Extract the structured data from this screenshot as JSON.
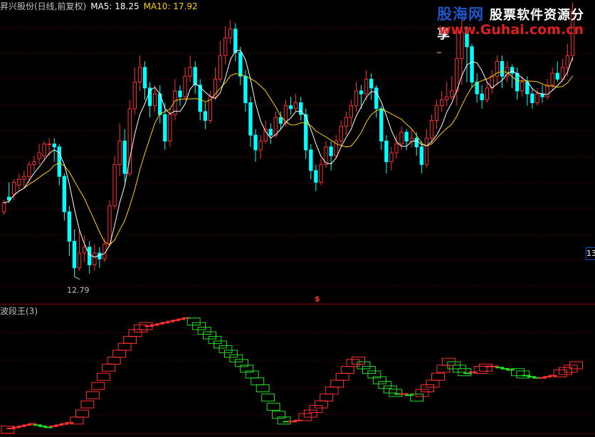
{
  "header": {
    "stock_label": "昇兴股份(日线,前复权)",
    "ma5_label": "MA5: 18.25",
    "ma10_label": "MA10: 17.92",
    "colors": {
      "title": "#c0c0c0",
      "ma5": "#ffffff",
      "ma10": "#ffd000"
    }
  },
  "indicator": {
    "title": "波段王(3)"
  },
  "watermark": {
    "brand": "股海网",
    "slogan": "股票软件资源分享",
    "url": "www.Guhai.com.cn"
  },
  "axis": {
    "right_label": "13"
  },
  "annotations": {
    "low_label": "12.79",
    "marker": "$"
  },
  "chart_data": [
    {
      "type": "candlestick",
      "title": "",
      "xlabel": "",
      "ylabel": "",
      "ylim": [
        12.3,
        21.8
      ],
      "grid": true,
      "colors": {
        "up": "#ff3030",
        "down": "#00ffff",
        "ma5": "#ffffff",
        "ma10": "#ffd000",
        "grid": "#7a0000"
      },
      "candles": [
        [
          15.0,
          15.3,
          15.4,
          14.9
        ],
        [
          15.5,
          15.4,
          16.0,
          15.3
        ],
        [
          15.6,
          16.0,
          16.1,
          15.4
        ],
        [
          15.9,
          16.1,
          16.3,
          15.7
        ],
        [
          16.1,
          16.2,
          16.4,
          15.8
        ],
        [
          16.2,
          16.6,
          16.7,
          16.0
        ],
        [
          16.6,
          16.7,
          16.9,
          16.4
        ],
        [
          16.8,
          17.0,
          17.3,
          16.6
        ],
        [
          16.9,
          17.3,
          17.4,
          16.7
        ],
        [
          17.3,
          17.3,
          17.5,
          16.9
        ],
        [
          17.3,
          17.2,
          17.5,
          16.7
        ],
        [
          17.2,
          16.2,
          17.3,
          15.9
        ],
        [
          16.2,
          15.0,
          16.3,
          14.7
        ],
        [
          15.0,
          14.0,
          15.2,
          13.5
        ],
        [
          14.0,
          13.1,
          14.4,
          12.8
        ],
        [
          13.1,
          13.6,
          14.4,
          13.0
        ],
        [
          13.6,
          13.8,
          14.2,
          13.3
        ],
        [
          13.8,
          13.2,
          14.0,
          12.9
        ],
        [
          13.2,
          13.6,
          13.9,
          13.0
        ],
        [
          13.6,
          13.4,
          13.8,
          13.1
        ],
        [
          13.4,
          13.9,
          14.1,
          13.3
        ],
        [
          13.9,
          15.2,
          15.4,
          13.8
        ],
        [
          15.2,
          16.6,
          16.9,
          15.1
        ],
        [
          16.6,
          17.4,
          18.0,
          16.2
        ],
        [
          17.4,
          16.3,
          17.8,
          16.0
        ],
        [
          16.3,
          18.5,
          18.8,
          16.2
        ],
        [
          18.5,
          19.4,
          19.9,
          18.3
        ],
        [
          19.4,
          19.9,
          20.3,
          19.1
        ],
        [
          19.9,
          19.2,
          20.1,
          18.8
        ],
        [
          19.2,
          18.6,
          19.4,
          18.2
        ],
        [
          18.6,
          19.0,
          19.3,
          18.4
        ],
        [
          19.0,
          18.3,
          19.3,
          18.0
        ],
        [
          18.3,
          17.4,
          18.7,
          17.1
        ],
        [
          17.4,
          18.3,
          18.5,
          17.2
        ],
        [
          18.3,
          19.1,
          19.5,
          18.1
        ],
        [
          19.1,
          18.9,
          19.3,
          18.6
        ],
        [
          18.9,
          19.6,
          19.9,
          18.8
        ],
        [
          19.6,
          19.9,
          20.3,
          19.4
        ],
        [
          19.9,
          19.3,
          20.1,
          19.0
        ],
        [
          19.3,
          18.4,
          19.5,
          18.1
        ],
        [
          18.4,
          18.1,
          18.7,
          17.8
        ],
        [
          18.1,
          18.9,
          19.1,
          18.0
        ],
        [
          18.9,
          19.5,
          19.9,
          18.8
        ],
        [
          19.5,
          20.3,
          20.8,
          19.4
        ],
        [
          20.3,
          20.9,
          21.3,
          20.0
        ],
        [
          20.9,
          21.2,
          21.5,
          20.7
        ],
        [
          21.2,
          20.4,
          21.4,
          20.1
        ],
        [
          20.4,
          19.6,
          20.6,
          19.3
        ],
        [
          19.6,
          18.7,
          19.8,
          18.4
        ],
        [
          18.7,
          17.6,
          18.9,
          17.2
        ],
        [
          17.6,
          17.1,
          17.8,
          16.7
        ],
        [
          17.1,
          17.4,
          17.6,
          16.8
        ],
        [
          17.4,
          17.8,
          18.1,
          17.3
        ],
        [
          17.8,
          17.6,
          18.0,
          17.3
        ],
        [
          17.6,
          18.2,
          18.4,
          17.5
        ],
        [
          18.2,
          18.0,
          18.4,
          17.8
        ],
        [
          18.0,
          18.6,
          18.8,
          17.9
        ],
        [
          18.6,
          18.5,
          18.9,
          18.3
        ],
        [
          18.5,
          18.7,
          19.0,
          18.4
        ],
        [
          18.7,
          18.3,
          18.9,
          18.1
        ],
        [
          18.3,
          17.1,
          18.5,
          16.8
        ],
        [
          17.1,
          16.4,
          17.3,
          16.1
        ],
        [
          16.4,
          16.0,
          16.6,
          15.7
        ],
        [
          16.0,
          16.6,
          16.8,
          15.9
        ],
        [
          16.6,
          17.2,
          17.4,
          16.5
        ],
        [
          17.2,
          16.9,
          17.4,
          16.4
        ],
        [
          16.9,
          17.4,
          17.6,
          16.8
        ],
        [
          17.4,
          17.9,
          18.1,
          17.2
        ],
        [
          17.9,
          18.2,
          18.4,
          17.6
        ],
        [
          18.2,
          18.6,
          18.8,
          17.9
        ],
        [
          18.6,
          19.1,
          19.4,
          18.4
        ],
        [
          19.1,
          19.0,
          19.3,
          18.5
        ],
        [
          19.0,
          19.5,
          19.8,
          18.8
        ],
        [
          19.5,
          19.2,
          19.7,
          18.8
        ],
        [
          19.2,
          18.5,
          19.3,
          18.2
        ],
        [
          18.5,
          17.4,
          18.6,
          17.1
        ],
        [
          17.4,
          16.7,
          17.6,
          16.3
        ],
        [
          16.7,
          17.0,
          17.2,
          16.4
        ],
        [
          17.0,
          17.3,
          17.6,
          16.8
        ],
        [
          17.3,
          17.7,
          17.9,
          17.1
        ],
        [
          17.7,
          17.4,
          17.8,
          17.1
        ],
        [
          17.4,
          17.5,
          17.8,
          17.2
        ],
        [
          17.5,
          17.2,
          17.7,
          16.9
        ],
        [
          17.2,
          16.6,
          17.4,
          16.3
        ],
        [
          16.6,
          17.5,
          17.8,
          16.5
        ],
        [
          17.5,
          18.1,
          18.3,
          17.3
        ],
        [
          18.1,
          18.6,
          18.8,
          17.8
        ],
        [
          18.6,
          18.8,
          19.1,
          18.4
        ],
        [
          18.8,
          18.9,
          19.4,
          18.6
        ],
        [
          18.9,
          19.1,
          19.6,
          18.8
        ],
        [
          19.1,
          20.2,
          21.3,
          18.6
        ],
        [
          20.2,
          21.1,
          21.6,
          19.3
        ],
        [
          21.1,
          20.6,
          21.3,
          19.4
        ],
        [
          20.6,
          19.4,
          20.7,
          19.2
        ],
        [
          19.4,
          19.0,
          19.7,
          18.7
        ],
        [
          19.0,
          18.8,
          19.3,
          18.5
        ],
        [
          18.8,
          19.2,
          19.4,
          18.7
        ],
        [
          19.2,
          19.6,
          19.8,
          19.0
        ],
        [
          19.6,
          20.1,
          20.3,
          19.3
        ],
        [
          20.1,
          19.6,
          20.3,
          19.2
        ],
        [
          19.6,
          19.9,
          20.1,
          19.4
        ],
        [
          19.9,
          19.7,
          20.0,
          19.2
        ],
        [
          19.7,
          19.1,
          19.9,
          18.8
        ],
        [
          19.1,
          19.4,
          19.6,
          18.9
        ],
        [
          19.4,
          19.0,
          19.6,
          18.6
        ],
        [
          19.0,
          18.7,
          19.2,
          18.5
        ],
        [
          18.7,
          19.0,
          19.2,
          18.6
        ],
        [
          19.0,
          18.9,
          19.3,
          18.7
        ],
        [
          18.9,
          19.3,
          19.5,
          18.8
        ],
        [
          19.3,
          19.7,
          19.9,
          19.1
        ],
        [
          19.7,
          19.5,
          20.1,
          19.4
        ],
        [
          19.5,
          19.9,
          20.2,
          19.4
        ],
        [
          19.9,
          20.3,
          20.7,
          19.6
        ],
        [
          20.3,
          21.8,
          22.1,
          20.1
        ]
      ]
    },
    {
      "type": "step",
      "title": "",
      "xlabel": "",
      "ylabel": "",
      "ylim": [
        0,
        100
      ],
      "colors": {
        "up": "#ff3030",
        "down": "#22dd22"
      },
      "values": [
        2,
        3,
        4,
        5,
        6,
        7,
        6,
        5,
        4,
        5,
        6,
        7,
        8,
        10,
        16,
        24,
        32,
        40,
        48,
        56,
        62,
        68,
        74,
        80,
        86,
        90,
        92,
        92,
        93,
        94,
        95,
        96,
        97,
        98,
        99,
        96,
        92,
        88,
        84,
        80,
        76,
        72,
        68,
        64,
        60,
        55,
        50,
        44,
        38,
        30,
        22,
        15,
        10,
        9,
        9,
        10,
        13,
        16,
        20,
        24,
        30,
        36,
        42,
        48,
        54,
        60,
        62,
        58,
        54,
        50,
        45,
        41,
        37,
        34,
        33,
        33,
        32,
        30,
        34,
        38,
        42,
        48,
        55,
        61,
        58,
        55,
        52,
        51,
        52,
        54,
        56,
        57,
        57,
        56,
        55,
        54,
        52,
        50,
        49,
        48,
        47,
        47,
        48,
        49,
        51,
        53,
        55,
        58
      ]
    }
  ]
}
